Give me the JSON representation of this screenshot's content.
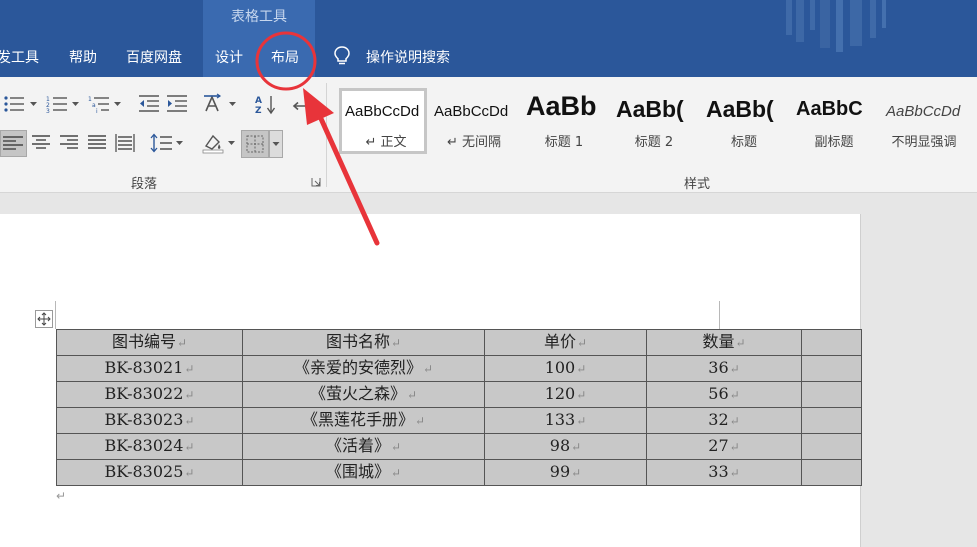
{
  "title_bar": {
    "context_group_title": "表格工具"
  },
  "tabs": {
    "developer": "发工具",
    "help": "帮助",
    "baidu_netdisk": "百度网盘",
    "design": "设计",
    "layout": "布局",
    "tell_me": "操作说明搜索"
  },
  "ribbon": {
    "paragraph_group_label": "段落",
    "styles_group_label": "样式",
    "styles": [
      {
        "sample": "AaBbCcDd",
        "name": "↵ 正文"
      },
      {
        "sample": "AaBbCcDd",
        "name": "↵ 无间隔"
      },
      {
        "sample": "AaBb",
        "name": "标题 1"
      },
      {
        "sample": "AaBb(",
        "name": "标题 2"
      },
      {
        "sample": "AaBb(",
        "name": "标题"
      },
      {
        "sample": "AaBbC",
        "name": "副标题"
      },
      {
        "sample": "AaBbCcDd",
        "name": "不明显强调"
      }
    ]
  },
  "table": {
    "mark": "↵",
    "headers": [
      "图书编号",
      "图书名称",
      "单价",
      "数量",
      ""
    ],
    "rows": [
      [
        "BK-83021",
        "《亲爱的安德烈》",
        "100",
        "36",
        ""
      ],
      [
        "BK-83022",
        "《萤火之森》",
        "120",
        "56",
        ""
      ],
      [
        "BK-83023",
        "《黑莲花手册》",
        "133",
        "32",
        ""
      ],
      [
        "BK-83024",
        "《活着》",
        "98",
        "27",
        ""
      ],
      [
        "BK-83025",
        "《围城》",
        "99",
        "33",
        ""
      ]
    ]
  },
  "after_table_mark": "↵",
  "colors": {
    "title_bar": "#2b579a",
    "context_group": "#3a6ab0",
    "annotation": "#e8343a",
    "table_cell": "#c8c8c8"
  }
}
